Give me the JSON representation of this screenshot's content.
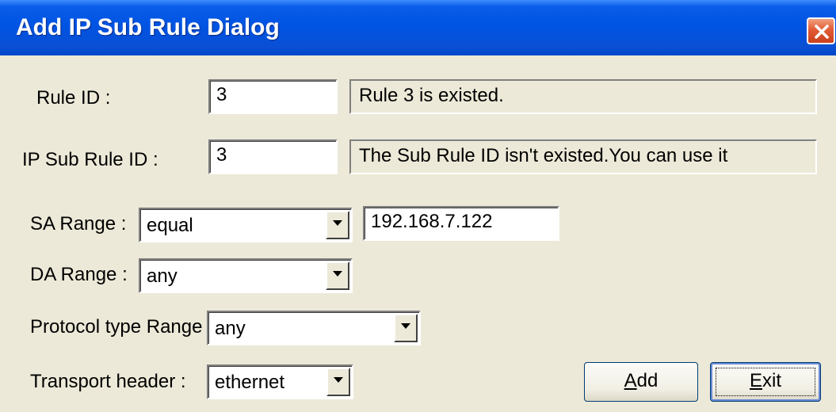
{
  "window": {
    "title": "Add IP Sub Rule Dialog"
  },
  "fields": {
    "rule_id": {
      "label": "Rule ID :",
      "value": "3",
      "status": "Rule 3 is existed."
    },
    "sub_rule_id": {
      "label": "IP Sub Rule ID :",
      "value": "3",
      "status": "The Sub Rule ID isn't existed.You can use it"
    },
    "sa_range": {
      "label": "SA Range :",
      "selected": "equal",
      "address": "192.168.7.122"
    },
    "da_range": {
      "label": "DA Range :",
      "selected": "any"
    },
    "protocol_range": {
      "label": "Protocol type Range :",
      "selected": "any"
    },
    "transport_header": {
      "label": "Transport header :",
      "selected": "ethernet"
    }
  },
  "buttons": {
    "add": {
      "mnemonic": "A",
      "rest": "dd"
    },
    "exit": {
      "mnemonic": "E",
      "rest": "xit"
    }
  }
}
